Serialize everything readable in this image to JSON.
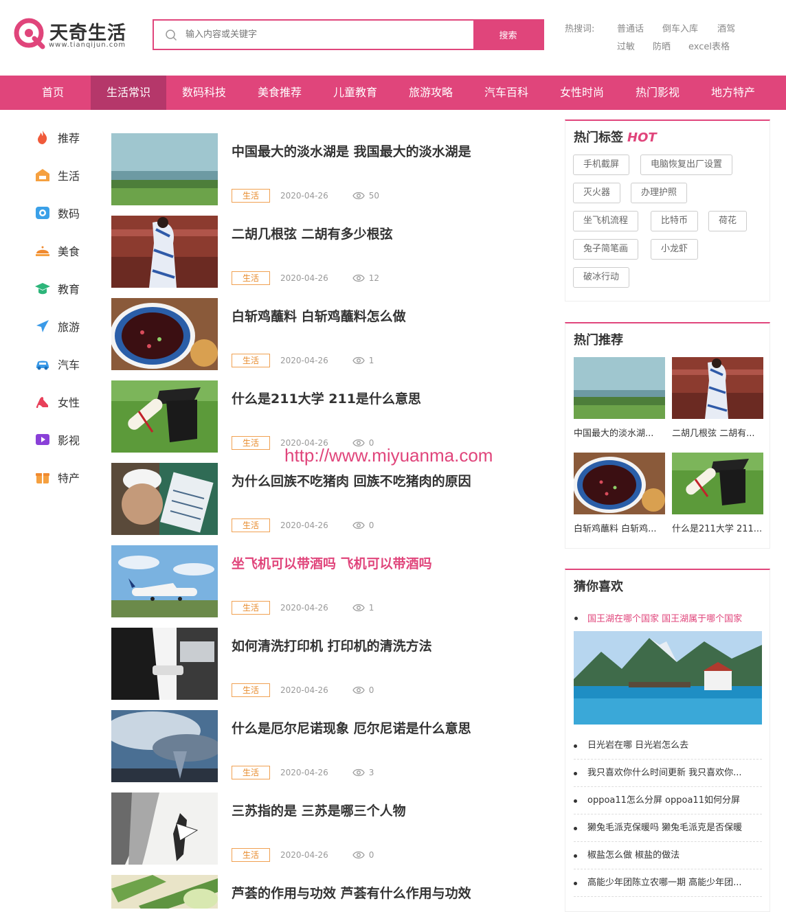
{
  "logo": {
    "name": "天奇生活",
    "url": "www.tianqijun.com"
  },
  "search": {
    "placeholder": "输入内容或关键字",
    "button": "搜索"
  },
  "hot_search": {
    "label": "热搜词:",
    "keywords": [
      "普通话",
      "倒车入库",
      "酒驾",
      "过敏",
      "防晒",
      "excel表格"
    ]
  },
  "nav": [
    "首页",
    "生活常识",
    "数码科技",
    "美食推荐",
    "儿童教育",
    "旅游攻略",
    "汽车百科",
    "女性时尚",
    "热门影视",
    "地方特产"
  ],
  "nav_active_index": 1,
  "side_nav": [
    {
      "label": "推荐",
      "icon": "flame-icon",
      "color": "#f05a3a"
    },
    {
      "label": "生活",
      "icon": "house-icon",
      "color": "#f5a040"
    },
    {
      "label": "数码",
      "icon": "camera-icon",
      "color": "#3aa0e8"
    },
    {
      "label": "美食",
      "icon": "dish-icon",
      "color": "#f08a30"
    },
    {
      "label": "教育",
      "icon": "graduation-cap-icon",
      "color": "#2db57a"
    },
    {
      "label": "旅游",
      "icon": "airplane-icon",
      "color": "#3a9ae8"
    },
    {
      "label": "汽车",
      "icon": "car-icon",
      "color": "#3a9ae8"
    },
    {
      "label": "女性",
      "icon": "high-heel-icon",
      "color": "#e8405a"
    },
    {
      "label": "影视",
      "icon": "video-icon",
      "color": "#8a40d8"
    },
    {
      "label": "特产",
      "icon": "gift-box-icon",
      "color": "#f5a040"
    }
  ],
  "articles": [
    {
      "title": "中国最大的淡水湖是 我国最大的淡水湖是",
      "tag": "生活",
      "date": "2020-04-26",
      "views": "50",
      "thumb": "lake"
    },
    {
      "title": "二胡几根弦 二胡有多少根弦",
      "tag": "生活",
      "date": "2020-04-26",
      "views": "12",
      "thumb": "erhu"
    },
    {
      "title": "白斩鸡蘸料 白斩鸡蘸料怎么做",
      "tag": "生活",
      "date": "2020-04-26",
      "views": "1",
      "thumb": "sauce"
    },
    {
      "title": "什么是211大学 211是什么意思",
      "tag": "生活",
      "date": "2020-04-26",
      "views": "0",
      "thumb": "diploma"
    },
    {
      "title": "为什么回族不吃猪肉 回族不吃猪肉的原因",
      "tag": "生活",
      "date": "2020-04-26",
      "views": "0",
      "thumb": "hui"
    },
    {
      "title": "坐飞机可以带酒吗 飞机可以带酒吗",
      "tag": "生活",
      "date": "2020-04-26",
      "views": "1",
      "thumb": "plane"
    },
    {
      "title": "如何清洗打印机 打印机的清洗方法",
      "tag": "生活",
      "date": "2020-04-26",
      "views": "0",
      "thumb": "printer"
    },
    {
      "title": "什么是厄尔尼诺现象 厄尔尼诺是什么意思",
      "tag": "生活",
      "date": "2020-04-26",
      "views": "3",
      "thumb": "storm"
    },
    {
      "title": "三苏指的是 三苏是哪三个人物",
      "tag": "生活",
      "date": "2020-04-26",
      "views": "0",
      "thumb": "ink"
    },
    {
      "title": "芦荟的作用与功效 芦荟有什么作用与功效",
      "tag": "",
      "date": "",
      "views": "",
      "thumb": "aloe"
    }
  ],
  "highlight_index": 5,
  "hot_tags": {
    "title": "热门标签",
    "badge": "HOT",
    "tags": [
      "手机截屏",
      "电脑恢复出厂设置",
      "灭火器",
      "办理护照",
      "坐飞机流程",
      "比特币",
      "荷花",
      "兔子简笔画",
      "小龙虾",
      "破冰行动"
    ]
  },
  "hot_recommend": {
    "title": "热门推荐",
    "items": [
      {
        "text": "中国最大的淡水湖...",
        "thumb": "lake"
      },
      {
        "text": "二胡几根弦 二胡有...",
        "thumb": "erhu"
      },
      {
        "text": "白斩鸡蘸料 白斩鸡...",
        "thumb": "sauce"
      },
      {
        "text": "什么是211大学 211...",
        "thumb": "diploma"
      }
    ]
  },
  "guess": {
    "title": "猜你喜欢",
    "first": "国王湖在哪个国家 国王湖属于哪个国家",
    "items": [
      "日光岩在哪 日光岩怎么去",
      "我只喜欢你什么时间更新 我只喜欢你...",
      "oppoa11怎么分屏 oppoa11如何分屏",
      "獭兔毛派克保暖吗 獭兔毛派克是否保暖",
      "椒盐怎么做 椒盐的做法",
      "高能少年团陈立农哪一期 高能少年团..."
    ]
  },
  "watermark": "http://www.miyuanma.com",
  "colors": {
    "brand": "#e0457b",
    "nav_active": "#b5376a",
    "tag_orange": "#e78a2b"
  }
}
